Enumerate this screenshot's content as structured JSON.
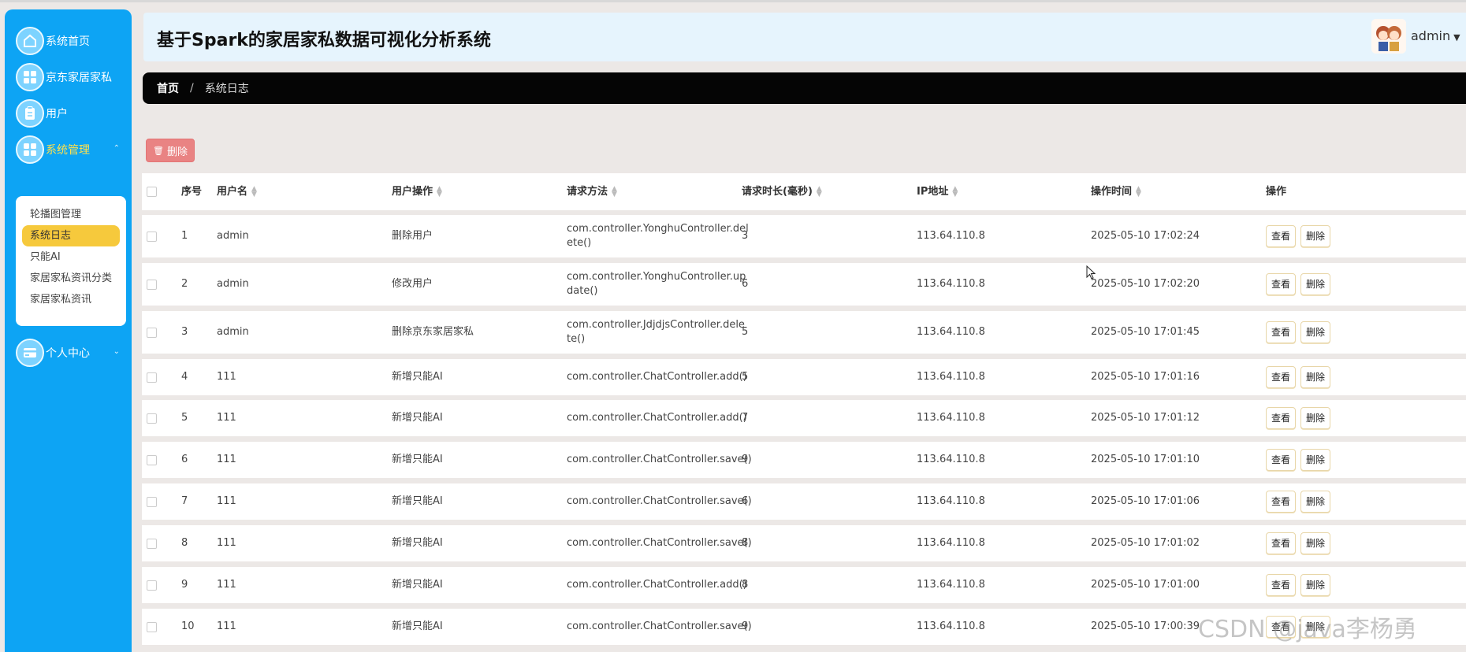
{
  "app": {
    "title": "基于Spark的家居家私数据可视化分析系统",
    "user": "admin",
    "accent": "#0da4f4"
  },
  "sidebar": {
    "items": [
      {
        "label": "系统首页",
        "icon": "home-icon"
      },
      {
        "label": "京东家居家私",
        "icon": "grid-icon"
      },
      {
        "label": "用户",
        "icon": "clipboard-icon"
      },
      {
        "label": "系统管理",
        "icon": "grid-icon",
        "expanded": true
      },
      {
        "label": "个人中心",
        "icon": "card-icon"
      }
    ],
    "submenu": [
      {
        "label": "轮播图管理"
      },
      {
        "label": "系统日志",
        "active": true
      },
      {
        "label": "只能AI"
      },
      {
        "label": "家居家私资讯分类"
      },
      {
        "label": "家居家私资讯"
      }
    ]
  },
  "breadcrumb": {
    "home": "首页",
    "separator": "/",
    "current": "系统日志"
  },
  "toolbar": {
    "delete_label": "删除"
  },
  "table": {
    "headers": [
      "序号",
      "用户名",
      "用户操作",
      "请求方法",
      "请求时长(毫秒)",
      "IP地址",
      "操作时间",
      "操作"
    ],
    "rows": [
      {
        "no": "1",
        "user": "admin",
        "op": "删除用户",
        "method1": "com.controller.YonghuController.del",
        "method2": "ete()",
        "duration": "3",
        "ip": "113.64.110.8",
        "time": "2025-05-10 17:02:24"
      },
      {
        "no": "2",
        "user": "admin",
        "op": "修改用户",
        "method1": "com.controller.YonghuController.up",
        "method2": "date()",
        "duration": "6",
        "ip": "113.64.110.8",
        "time": "2025-05-10 17:02:20"
      },
      {
        "no": "3",
        "user": "admin",
        "op": "删除京东家居家私",
        "method1": "com.controller.JdjdjsController.dele",
        "method2": "te()",
        "duration": "5",
        "ip": "113.64.110.8",
        "time": "2025-05-10 17:01:45"
      },
      {
        "no": "4",
        "user": "111",
        "op": "新增只能AI",
        "method1": "com.controller.ChatController.add()",
        "method2": "",
        "duration": "5",
        "ip": "113.64.110.8",
        "time": "2025-05-10 17:01:16"
      },
      {
        "no": "5",
        "user": "111",
        "op": "新增只能AI",
        "method1": "com.controller.ChatController.add()",
        "method2": "",
        "duration": "7",
        "ip": "113.64.110.8",
        "time": "2025-05-10 17:01:12"
      },
      {
        "no": "6",
        "user": "111",
        "op": "新增只能AI",
        "method1": "com.controller.ChatController.save()",
        "method2": "",
        "duration": "9",
        "ip": "113.64.110.8",
        "time": "2025-05-10 17:01:10"
      },
      {
        "no": "7",
        "user": "111",
        "op": "新增只能AI",
        "method1": "com.controller.ChatController.save()",
        "method2": "",
        "duration": "6",
        "ip": "113.64.110.8",
        "time": "2025-05-10 17:01:06"
      },
      {
        "no": "8",
        "user": "111",
        "op": "新增只能AI",
        "method1": "com.controller.ChatController.save()",
        "method2": "",
        "duration": "8",
        "ip": "113.64.110.8",
        "time": "2025-05-10 17:01:02"
      },
      {
        "no": "9",
        "user": "111",
        "op": "新增只能AI",
        "method1": "com.controller.ChatController.add()",
        "method2": "",
        "duration": "8",
        "ip": "113.64.110.8",
        "time": "2025-05-10 17:01:00"
      },
      {
        "no": "10",
        "user": "111",
        "op": "新增只能AI",
        "method1": "com.controller.ChatController.save()",
        "method2": "",
        "duration": "9",
        "ip": "113.64.110.8",
        "time": "2025-05-10 17:00:39"
      }
    ],
    "view_label": "查看",
    "delete_label": "删除"
  },
  "watermark": "CSDN @java李杨勇"
}
